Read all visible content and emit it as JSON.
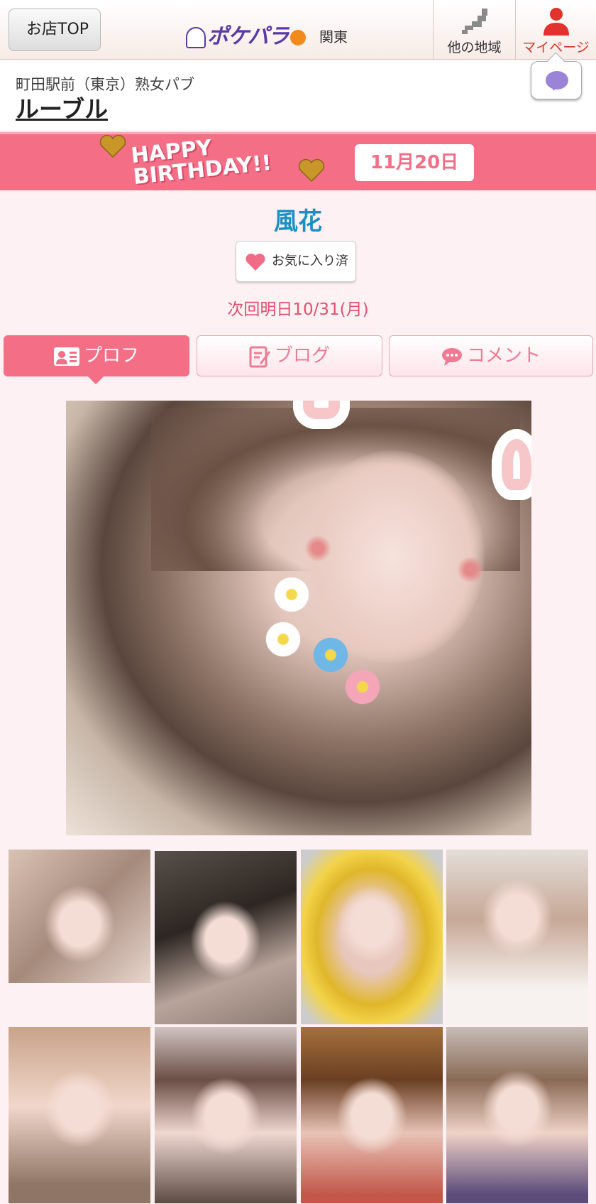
{
  "header": {
    "back_label": "お店TOP",
    "logo_text": "ポケパラ",
    "region": "関東",
    "other_region_label": "他の地域",
    "mypage_label": "マイページ"
  },
  "shop": {
    "subtitle": "町田駅前（東京）熟女パブ",
    "name": "ルーブル"
  },
  "birthday": {
    "banner_text_1": "HAPPY",
    "banner_text_2": "BIRTHDAY!!",
    "date": "11月20日"
  },
  "profile": {
    "name": "風花",
    "favorite_label": "お気に入り済",
    "next_attendance": "次回明日10/31(月)"
  },
  "tabs": [
    {
      "label": "プロフ",
      "active": true
    },
    {
      "label": "ブログ",
      "active": false
    },
    {
      "label": "コメント",
      "active": false
    }
  ],
  "colors": {
    "accent": "#f46e86",
    "name": "#1c8fc4",
    "mypage": "#e1322e"
  },
  "icons": {
    "back": "chevron-left-icon",
    "map": "japan-map-icon",
    "person": "person-icon",
    "chat": "chat-bubble-icon",
    "heart": "heart-icon",
    "profile_card": "profile-card-icon",
    "blog": "edit-note-icon",
    "comment": "comment-icon"
  }
}
